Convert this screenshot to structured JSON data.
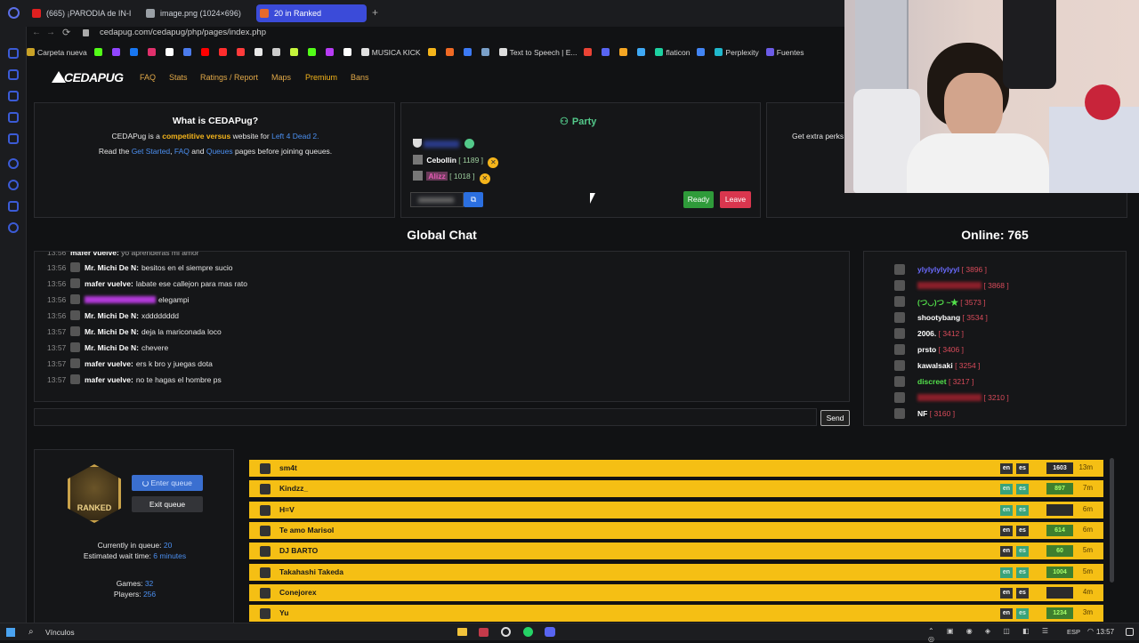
{
  "browser": {
    "tabs": [
      {
        "label": "(665) ¡PARODIA de IN-I",
        "favicon_color": "#e02020"
      },
      {
        "label": "image.png (1024×696)",
        "favicon_color": "#9aa0a6"
      },
      {
        "label": "20 in Ranked",
        "favicon_color": "#e86a2b",
        "active": true
      }
    ],
    "url": "cedapug.com/cedapug/php/pages/index.php",
    "bookmarks": [
      {
        "label": "Carpeta nueva",
        "color": "#c9a227"
      },
      {
        "label": "",
        "color": "#53fc18"
      },
      {
        "label": "",
        "color": "#9146ff"
      },
      {
        "label": "",
        "color": "#1877f2"
      },
      {
        "label": "",
        "color": "#e1306c"
      },
      {
        "label": "",
        "color": "#ffffff"
      },
      {
        "label": "",
        "color": "#4b7bec"
      },
      {
        "label": "",
        "color": "#ff0000"
      },
      {
        "label": "",
        "color": "#ff2d2d"
      },
      {
        "label": "",
        "color": "#ff3b3b"
      },
      {
        "label": "",
        "color": "#e8e8e8"
      },
      {
        "label": "",
        "color": "#cccccc"
      },
      {
        "label": "",
        "color": "#c6f53c"
      },
      {
        "label": "",
        "color": "#53fc18"
      },
      {
        "label": "",
        "color": "#b83cf5"
      },
      {
        "label": "",
        "color": "#ffffff"
      },
      {
        "label": "MUSICA KICK",
        "color": "#e0e0e0"
      },
      {
        "label": "",
        "color": "#f5b51b"
      },
      {
        "label": "",
        "color": "#f06a24"
      },
      {
        "label": "",
        "color": "#3c7af5"
      },
      {
        "label": "",
        "color": "#7aa0c9"
      },
      {
        "label": "Text to Speech | E...",
        "color": "#dddddd"
      },
      {
        "label": "",
        "color": "#ea4335"
      },
      {
        "label": "",
        "color": "#5865f2"
      },
      {
        "label": "",
        "color": "#f5a623"
      },
      {
        "label": "",
        "color": "#3fa9f5"
      },
      {
        "label": "flaticon",
        "color": "#1dd1a1"
      },
      {
        "label": "",
        "color": "#4285f4"
      },
      {
        "label": "Perplexity",
        "color": "#20b8cd"
      },
      {
        "label": "Fuentes",
        "color": "#6c5ce7"
      }
    ]
  },
  "site": {
    "logo": "CEDAPUG",
    "nav": [
      "FAQ",
      "Stats",
      "Ratings / Report",
      "Maps",
      "Premium",
      "Bans"
    ]
  },
  "about": {
    "title": "What is CEDAPug?",
    "line1_a": "CEDAPug is a",
    "line1_b": "competitive versus",
    "line1_c": "website for",
    "line1_d": "Left 4 Dead 2.",
    "line2_a": "Read the",
    "line2_b": "Get Started",
    "line2_c": "FAQ",
    "line2_d": "and",
    "line2_e": "Queues",
    "line2_f": "pages before joining queues."
  },
  "party": {
    "title": "Party",
    "members": [
      {
        "name": "",
        "elo": ""
      },
      {
        "name": "Cebollin",
        "elo": "1189"
      },
      {
        "name": "Alizz",
        "elo": "1018"
      }
    ],
    "ready": "Ready",
    "leave": "Leave"
  },
  "perks": {
    "text": "Get extra perks"
  },
  "chat": {
    "title": "Global Chat",
    "send": "Send",
    "messages": [
      {
        "time": "13:56",
        "user": "Mr. Michi De N:",
        "text": "besitos en el siempre sucio"
      },
      {
        "time": "13:56",
        "user": "mafer vuelve:",
        "text": "labate ese callejon para mas rato"
      },
      {
        "time": "13:56",
        "user": "",
        "text": "elegampi"
      },
      {
        "time": "13:56",
        "user": "Mr. Michi De N:",
        "text": "xdddddddd"
      },
      {
        "time": "13:57",
        "user": "Mr. Michi De N:",
        "text": "deja la mariconada loco"
      },
      {
        "time": "13:57",
        "user": "Mr. Michi De N:",
        "text": "chevere"
      },
      {
        "time": "13:57",
        "user": "mafer vuelve:",
        "text": "ers k bro y juegas dota"
      },
      {
        "time": "13:57",
        "user": "mafer vuelve:",
        "text": "no te hagas el hombre ps"
      }
    ]
  },
  "online": {
    "title": "Online: 765",
    "users": [
      {
        "name": "ylylylylylyyl",
        "elo": "3896",
        "color": "#6b6bff"
      },
      {
        "name": "",
        "elo": "3868",
        "color": "#8a1f2a"
      },
      {
        "name": "(つ◡︎)つ ~★",
        "elo": "3573",
        "color": "#53e04b"
      },
      {
        "name": "shootybang",
        "elo": "3534",
        "color": "#ffffff"
      },
      {
        "name": "2006.",
        "elo": "3412",
        "color": "#ffffff"
      },
      {
        "name": "prsto",
        "elo": "3406",
        "color": "#ffffff"
      },
      {
        "name": "kawalsaki",
        "elo": "3254",
        "color": "#ffffff"
      },
      {
        "name": "discreet",
        "elo": "3217",
        "color": "#53e04b"
      },
      {
        "name": "",
        "elo": "3210",
        "color": "#8a1f2a"
      },
      {
        "name": "NF",
        "elo": "3160",
        "color": "#ffffff"
      }
    ]
  },
  "queue_panel": {
    "badge": "RANKED",
    "enter": "Enter queue",
    "exit": "Exit queue",
    "in_queue_label": "Currently in queue:",
    "in_queue_value": "20",
    "wait_label": "Estimated wait time:",
    "wait_value": "6 minutes",
    "games_label": "Games:",
    "games_value": "32",
    "players_label": "Players:",
    "players_value": "256"
  },
  "queue": [
    {
      "name": "sm4t",
      "en": "on",
      "es": "on",
      "elo": "1603",
      "elo_style": "dark",
      "age": "13m"
    },
    {
      "name": "Kindzz_",
      "en": "off",
      "es": "off",
      "elo": "897",
      "elo_style": "green",
      "age": "7m"
    },
    {
      "name": "H=V",
      "en": "off",
      "es": "off",
      "elo": "",
      "elo_style": "dark",
      "age": "6m"
    },
    {
      "name": "Te amo Marisol",
      "en": "on",
      "es": "on",
      "elo": "614",
      "elo_style": "green",
      "age": "6m"
    },
    {
      "name": "DJ BARTO",
      "en": "on",
      "es": "off",
      "elo": "60",
      "elo_style": "green",
      "age": "5m"
    },
    {
      "name": "Takahashi Takeda",
      "en": "off",
      "es": "off",
      "elo": "1004",
      "elo_style": "green",
      "age": "5m"
    },
    {
      "name": "Conejorex",
      "en": "on",
      "es": "on",
      "elo": "",
      "elo_style": "dark",
      "age": "4m"
    },
    {
      "name": "Yu",
      "en": "on",
      "es": "off",
      "elo": "1234",
      "elo_style": "green",
      "age": "3m"
    }
  ],
  "taskbar": {
    "search": "Vínculos",
    "lang": "ESP",
    "time": "13:57"
  }
}
